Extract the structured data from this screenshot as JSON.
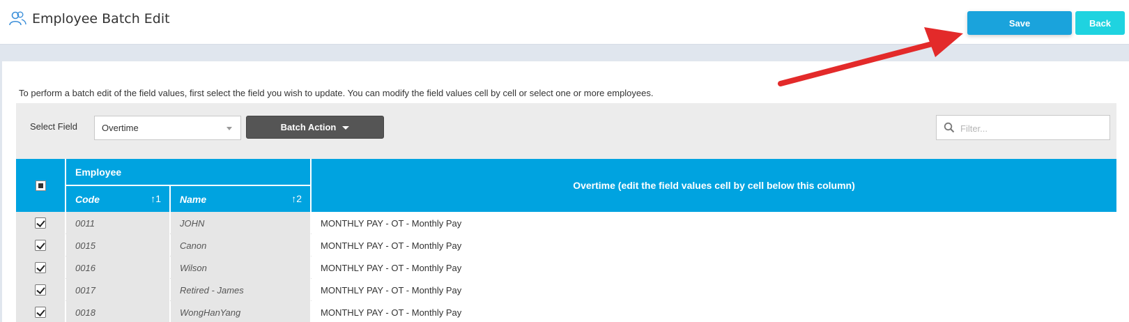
{
  "header": {
    "title": "Employee Batch Edit",
    "save_label": "Save",
    "back_label": "Back"
  },
  "instructions": "To perform a batch edit of the field values, first select the field you wish to update. You can modify the field values cell by cell or select one or more employees.",
  "toolbar": {
    "select_label": "Select Field",
    "select_value": "Overtime",
    "batch_action_label": "Batch Action",
    "filter_placeholder": "Filter..."
  },
  "table": {
    "group_header": "Employee",
    "col_code": "Code",
    "col_code_sort": "↑1",
    "col_name": "Name",
    "col_name_sort": "↑2",
    "col_value": "Overtime (edit the field values cell by cell below this column)",
    "rows": [
      {
        "code": "0011",
        "name": "JOHN",
        "value": "MONTHLY PAY - OT - Monthly Pay",
        "checked": true
      },
      {
        "code": "0015",
        "name": "Canon",
        "value": "MONTHLY PAY - OT - Monthly Pay",
        "checked": true
      },
      {
        "code": "0016",
        "name": "Wilson",
        "value": "MONTHLY PAY - OT - Monthly Pay",
        "checked": true
      },
      {
        "code": "0017",
        "name": "Retired - James",
        "value": "MONTHLY PAY - OT - Monthly Pay",
        "checked": true
      },
      {
        "code": "0018",
        "name": "WongHanYang",
        "value": "MONTHLY PAY - OT - Monthly Pay",
        "checked": true
      }
    ]
  },
  "colors": {
    "accent": "#00a3e0",
    "save": "#1aa3dc",
    "back": "#1fd3e0",
    "annotation_arrow": "#e32a2a"
  }
}
